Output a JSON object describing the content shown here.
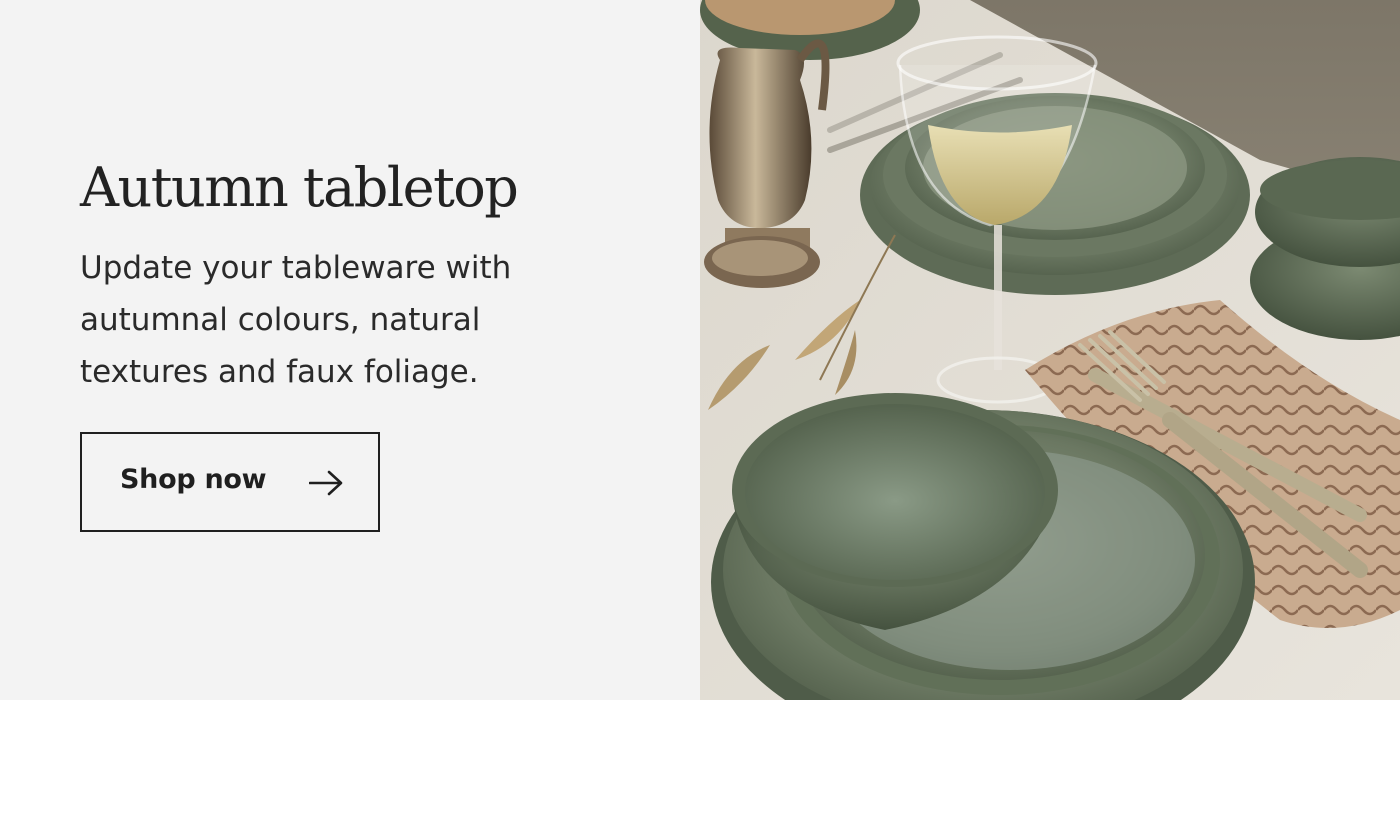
{
  "banner": {
    "headline": "Autumn tabletop",
    "description": "Update your tableware with autumnal colours, natural textures and faux foliage.",
    "cta_label": "Shop now",
    "cta_icon": "arrow-right-icon"
  },
  "colors": {
    "panel_background": "#f3f3f3",
    "text": "#222222",
    "button_border": "#1f1f1f",
    "stoneware_green": "#6f7d64",
    "tablecloth": "#e4e0d8"
  }
}
